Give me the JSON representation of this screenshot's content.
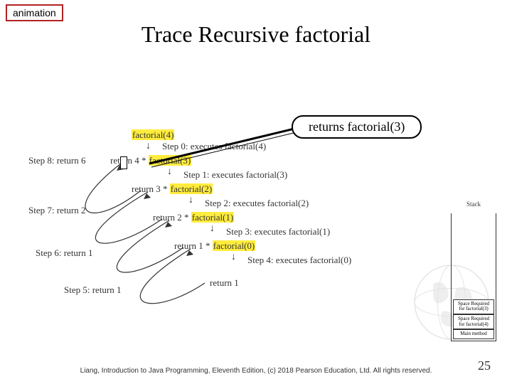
{
  "tag": "animation",
  "title": "Trace Recursive factorial",
  "callout": "returns factorial(3)",
  "trace": {
    "root": "factorial(4)",
    "step0": "Step 0: executes factorial(4)",
    "ret4": {
      "pre": "return 4 * ",
      "call": "factorial(3)"
    },
    "step1": "Step 1: executes factorial(3)",
    "ret3": {
      "pre": "return 3 * ",
      "call": "factorial(2)"
    },
    "step2": "Step 2: executes factorial(2)",
    "ret2": {
      "pre": "return 2 * ",
      "call": "factorial(1)"
    },
    "step3": "Step 3: executes factorial(1)",
    "ret1": {
      "pre": "return 1 * ",
      "call": "factorial(0)"
    },
    "step4": "Step 4: executes factorial(0)",
    "ret0": "return 1",
    "step5": "Step 5: return 1",
    "step6": "Step 6: return 1",
    "step7": "Step 7: return 2",
    "step8": "Step 8: return 6"
  },
  "stack": {
    "title": "Stack",
    "frames": [
      "Space Required for factorial(3)",
      "Space Required for factorial(4)",
      "Main method"
    ]
  },
  "footer": "Liang, Introduction to Java Programming, Eleventh Edition, (c) 2018 Pearson Education, Ltd. All rights reserved.",
  "page": "25"
}
